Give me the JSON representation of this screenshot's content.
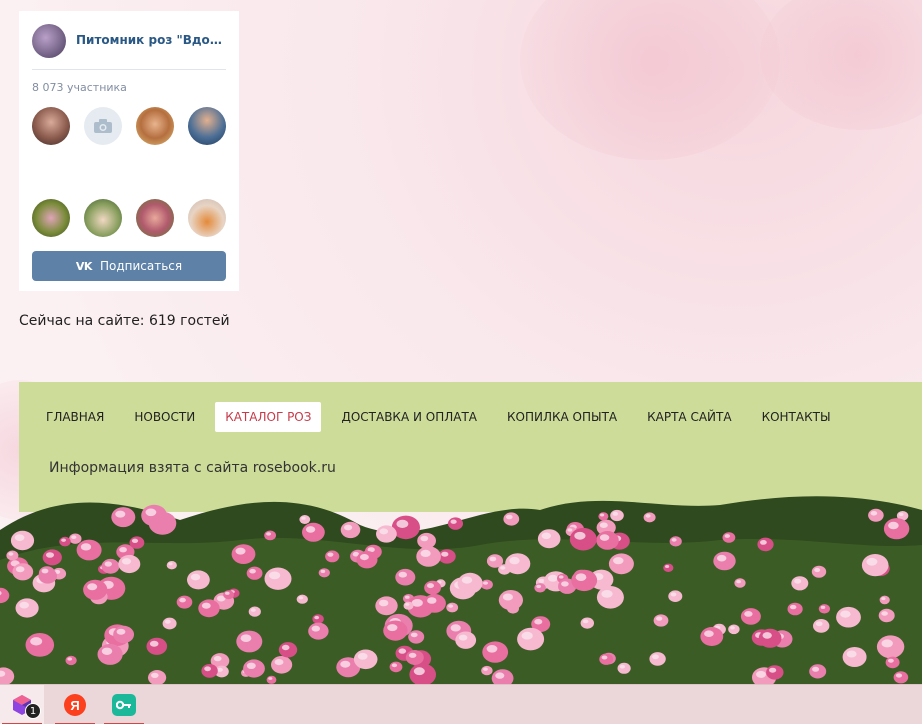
{
  "vk_widget": {
    "group_name": "Питомник роз \"Вдохновение\"",
    "members_count": "8 073 участника",
    "subscribe_label": "Подписаться",
    "vk_logo_text": "VK"
  },
  "online": {
    "text": "Сейчас на сайте: 619 гостей"
  },
  "menu": {
    "items": [
      {
        "label": "ГЛАВНАЯ",
        "active": false
      },
      {
        "label": "НОВОСТИ",
        "active": false
      },
      {
        "label": "КАТАЛОГ РОЗ",
        "active": true
      },
      {
        "label": "ДОСТАВКА И ОПЛАТА",
        "active": false
      },
      {
        "label": "КОПИЛКА ОПЫТА",
        "active": false
      },
      {
        "label": "КАРТА САЙТА",
        "active": false
      },
      {
        "label": "КОНТАКТЫ",
        "active": false
      }
    ],
    "info": "Информация взята с сайта rosebook.ru"
  },
  "taskbar": {
    "apps": [
      {
        "name": "app-gem",
        "badge": "1",
        "active": true
      },
      {
        "name": "yandex-browser",
        "glyph": "Я",
        "active": false
      },
      {
        "name": "key-app",
        "active": false
      }
    ]
  },
  "colors": {
    "vk_blue": "#5e81a8",
    "menu_bg": "#cddc99",
    "active_menu_text": "#c73a4a",
    "rose_pink": "#e86fa0"
  }
}
